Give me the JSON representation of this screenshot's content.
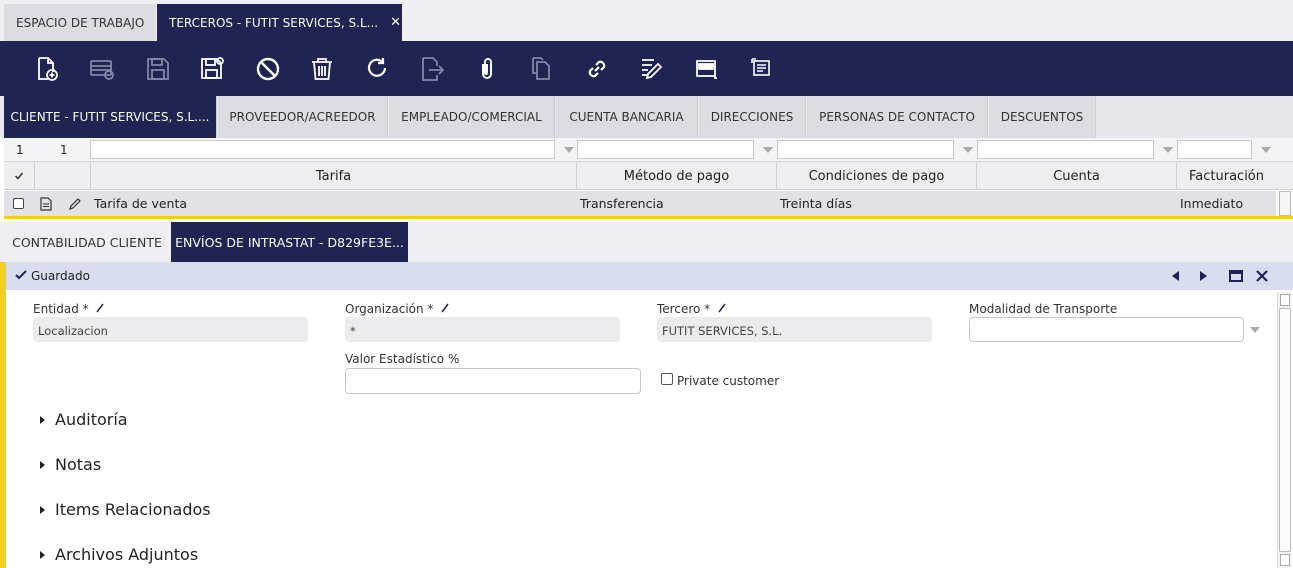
{
  "top_tabs": [
    {
      "label": "ESPACIO DE TRABAJO"
    },
    {
      "label": "TERCEROS - FUTIT SERVICES, S.L...",
      "close": "✕"
    }
  ],
  "toolbar": {
    "icons": [
      "new-document-icon",
      "new-row-icon",
      "save-icon",
      "save-close-icon",
      "undo-icon",
      "delete-icon",
      "refresh-icon",
      "export-icon",
      "attach-icon",
      "copy-icon",
      "link-icon",
      "edit-list-icon",
      "form-view-icon",
      "notes-icon"
    ]
  },
  "header_tabs": [
    {
      "label": "CLIENTE - FUTIT SERVICES, S.L...."
    },
    {
      "label": "PROVEEDOR/ACREEDOR"
    },
    {
      "label": "EMPLEADO/COMERCIAL"
    },
    {
      "label": "CUENTA BANCARIA"
    },
    {
      "label": "DIRECCIONES"
    },
    {
      "label": "PERSONAS DE CONTACTO"
    },
    {
      "label": "DESCUENTOS"
    }
  ],
  "grid": {
    "row_count": "1",
    "selected_count": "1",
    "columns": [
      "Tarifa",
      "Método de pago",
      "Condiciones de pago",
      "Cuenta",
      "Facturación"
    ],
    "rows": [
      {
        "tarifa": "Tarifa de venta",
        "metodo": "Transferencia",
        "condiciones": "Treinta días",
        "cuenta": "",
        "facturacion": "Inmediato"
      }
    ]
  },
  "sub_tabs": [
    {
      "label": "CONTABILIDAD CLIENTE"
    },
    {
      "label": "ENVÍOS DE INTRASTAT - D829FE3E..."
    }
  ],
  "status": {
    "text": "Guardado"
  },
  "form": {
    "entidad_label": "Entidad *",
    "entidad_value": "Localizacion",
    "organizacion_label": "Organización *",
    "organizacion_value": "*",
    "tercero_label": "Tercero *",
    "tercero_value": "FUTIT SERVICES, S.L.",
    "modalidad_label": "Modalidad de Transporte",
    "modalidad_value": "",
    "valor_label": "Valor Estadístico %",
    "valor_value": "",
    "private_label": "Private customer",
    "private_checked": false
  },
  "sections": [
    "Auditoría",
    "Notas",
    "Items Relacionados",
    "Archivos Adjuntos"
  ],
  "colors": {
    "navy": "#202452",
    "accent": "#f1cf1d",
    "status_bg": "#dadcef"
  }
}
